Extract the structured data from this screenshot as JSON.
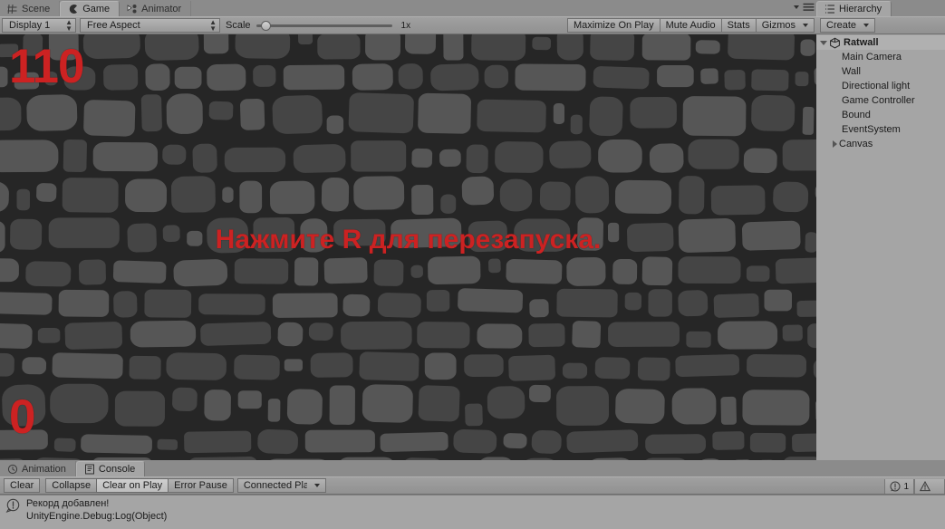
{
  "game_panel": {
    "tabs": [
      {
        "label": "Scene",
        "icon": "grid-icon",
        "active": false
      },
      {
        "label": "Game",
        "icon": "gamepad-icon",
        "active": true
      },
      {
        "label": "Animator",
        "icon": "animator-icon",
        "active": false
      }
    ],
    "tab_menu_icon": "hamburger-menu-icon",
    "tab_menu_caret_icon": "chevron-down-icon",
    "toolbar": {
      "display": "Display 1",
      "aspect": "Free Aspect",
      "scale_label": "Scale",
      "scale_value": "1x",
      "scale_fraction": 0.04,
      "maximize_on_play": "Maximize On Play",
      "mute_audio": "Mute Audio",
      "stats": "Stats",
      "gizmos": "Gizmos"
    },
    "view": {
      "score_top": "110",
      "score_bottom": "0",
      "restart_message": "Нажмите R для перезапуска.",
      "text_color": "#cc2222",
      "background_color": "#262626",
      "stone_color_light": "#565656",
      "stone_color_dark": "#454545"
    }
  },
  "hierarchy_panel": {
    "tabs": [
      {
        "label": "Hierarchy",
        "icon": "hierarchy-icon",
        "active": true
      }
    ],
    "toolbar": {
      "create_label": "Create"
    },
    "items": [
      {
        "label": "Ratwall",
        "depth": 0,
        "foldout": "open",
        "icon": "unity-scene-icon",
        "selected": true
      },
      {
        "label": "Main Camera",
        "depth": 1,
        "foldout": "none",
        "icon": "",
        "selected": false
      },
      {
        "label": "Wall",
        "depth": 1,
        "foldout": "none",
        "icon": "",
        "selected": false
      },
      {
        "label": "Directional light",
        "depth": 1,
        "foldout": "none",
        "icon": "",
        "selected": false
      },
      {
        "label": "Game Controller",
        "depth": 1,
        "foldout": "none",
        "icon": "",
        "selected": false
      },
      {
        "label": "Bound",
        "depth": 1,
        "foldout": "none",
        "icon": "",
        "selected": false
      },
      {
        "label": "EventSystem",
        "depth": 1,
        "foldout": "none",
        "icon": "",
        "selected": false
      },
      {
        "label": "Canvas",
        "depth": 1,
        "foldout": "closed",
        "icon": "",
        "selected": false
      }
    ]
  },
  "console_panel": {
    "tabs": [
      {
        "label": "Animation",
        "icon": "clock-icon",
        "active": false
      },
      {
        "label": "Console",
        "icon": "console-icon",
        "active": true
      }
    ],
    "toolbar": {
      "clear": "Clear",
      "collapse": "Collapse",
      "clear_on_play": "Clear on Play",
      "error_pause": "Error Pause",
      "connected_player": "Connected Playe",
      "warning_count": "1",
      "error_count": ""
    },
    "entries": [
      {
        "icon": "warning-icon",
        "line1": "Рекорд добавлен!",
        "line2": "UnityEngine.Debug:Log(Object)"
      }
    ]
  }
}
